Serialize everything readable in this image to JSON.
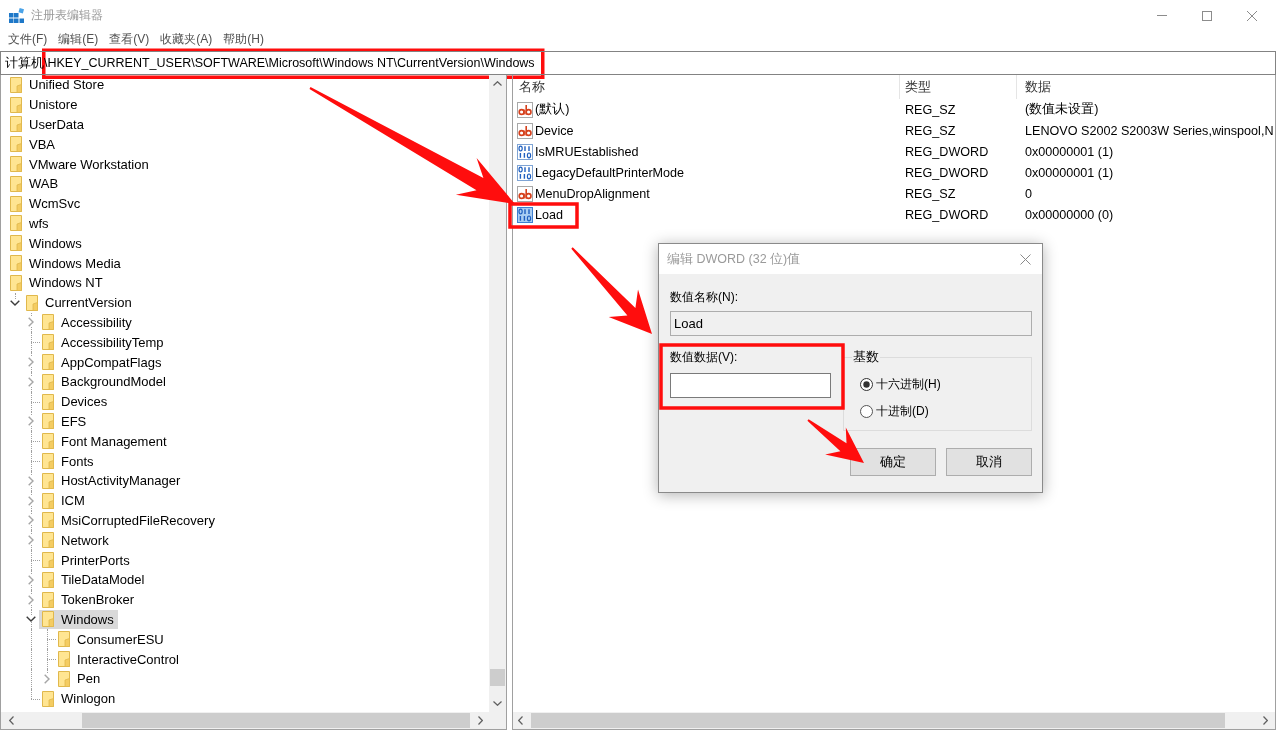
{
  "window": {
    "title": "注册表编辑器"
  },
  "menu": [
    "文件(F)",
    "编辑(E)",
    "查看(V)",
    "收藏夹(A)",
    "帮助(H)"
  ],
  "address_bar": {
    "value": "计算机\\HKEY_CURRENT_USER\\SOFTWARE\\Microsoft\\Windows NT\\CurrentVersion\\Windows"
  },
  "tree": [
    {
      "label": "Unified Store",
      "selected": false
    },
    {
      "label": "Unistore",
      "selected": false
    },
    {
      "label": "UserData",
      "selected": false
    },
    {
      "label": "VBA",
      "selected": false
    },
    {
      "label": "VMware Workstation",
      "selected": false
    },
    {
      "label": "WAB",
      "selected": false
    },
    {
      "label": "WcmSvc",
      "selected": false
    },
    {
      "label": "wfs",
      "selected": false
    },
    {
      "label": "Windows",
      "selected": false
    },
    {
      "label": "Windows Media",
      "selected": false
    },
    {
      "label": "Windows NT",
      "selected": false,
      "children": [
        {
          "label": "CurrentVersion",
          "selected": false,
          "expanded": true,
          "children": [
            {
              "label": "Accessibility",
              "selected": false,
              "expanded": false
            },
            {
              "label": "AccessibilityTemp",
              "selected": false
            },
            {
              "label": "AppCompatFlags",
              "selected": false,
              "expanded": false
            },
            {
              "label": "BackgroundModel",
              "selected": false,
              "expanded": false
            },
            {
              "label": "Devices",
              "selected": false
            },
            {
              "label": "EFS",
              "selected": false,
              "expanded": false
            },
            {
              "label": "Font Management",
              "selected": false
            },
            {
              "label": "Fonts",
              "selected": false
            },
            {
              "label": "HostActivityManager",
              "selected": false,
              "expanded": false
            },
            {
              "label": "ICM",
              "selected": false,
              "expanded": false
            },
            {
              "label": "MsiCorruptedFileRecovery",
              "selected": false,
              "expanded": false
            },
            {
              "label": "Network",
              "selected": false,
              "expanded": false
            },
            {
              "label": "PrinterPorts",
              "selected": false
            },
            {
              "label": "TileDataModel",
              "selected": false,
              "expanded": false
            },
            {
              "label": "TokenBroker",
              "selected": false,
              "expanded": false
            },
            {
              "label": "Windows",
              "selected": true,
              "expanded": true,
              "children": [
                {
                  "label": "ConsumerESU",
                  "selected": false
                },
                {
                  "label": "InteractiveControl",
                  "selected": false
                },
                {
                  "label": "Pen",
                  "selected": false,
                  "expanded": false
                }
              ]
            },
            {
              "label": "Winlogon",
              "selected": false
            }
          ]
        }
      ]
    }
  ],
  "values_list": {
    "columns": [
      "名称",
      "类型",
      "数据"
    ],
    "rows": [
      {
        "kind": "string",
        "name": "(默认)",
        "type": "REG_SZ",
        "data": "(数值未设置)",
        "selected": false
      },
      {
        "kind": "string",
        "name": "Device",
        "type": "REG_SZ",
        "data": "LENOVO S2002 S2003W Series,winspool,N",
        "selected": false
      },
      {
        "kind": "binary",
        "name": "IsMRUEstablished",
        "type": "REG_DWORD",
        "data": "0x00000001 (1)",
        "selected": false
      },
      {
        "kind": "binary",
        "name": "LegacyDefaultPrinterMode",
        "type": "REG_DWORD",
        "data": "0x00000001 (1)",
        "selected": false
      },
      {
        "kind": "string",
        "name": "MenuDropAlignment",
        "type": "REG_SZ",
        "data": "0",
        "selected": false
      },
      {
        "kind": "binary",
        "name": "Load",
        "type": "REG_DWORD",
        "data": "0x00000000 (0)",
        "selected": true
      }
    ]
  },
  "dialog": {
    "title": "编辑 DWORD (32 位)值",
    "name_label": "数值名称(N):",
    "name_value": "Load",
    "data_label": "数值数据(V):",
    "base": {
      "title": "基数",
      "options": [
        {
          "label": "十六进制(H)",
          "selected": true
        },
        {
          "label": "十进制(D)",
          "selected": false
        }
      ]
    },
    "buttons": [
      "确定",
      "取消"
    ]
  }
}
